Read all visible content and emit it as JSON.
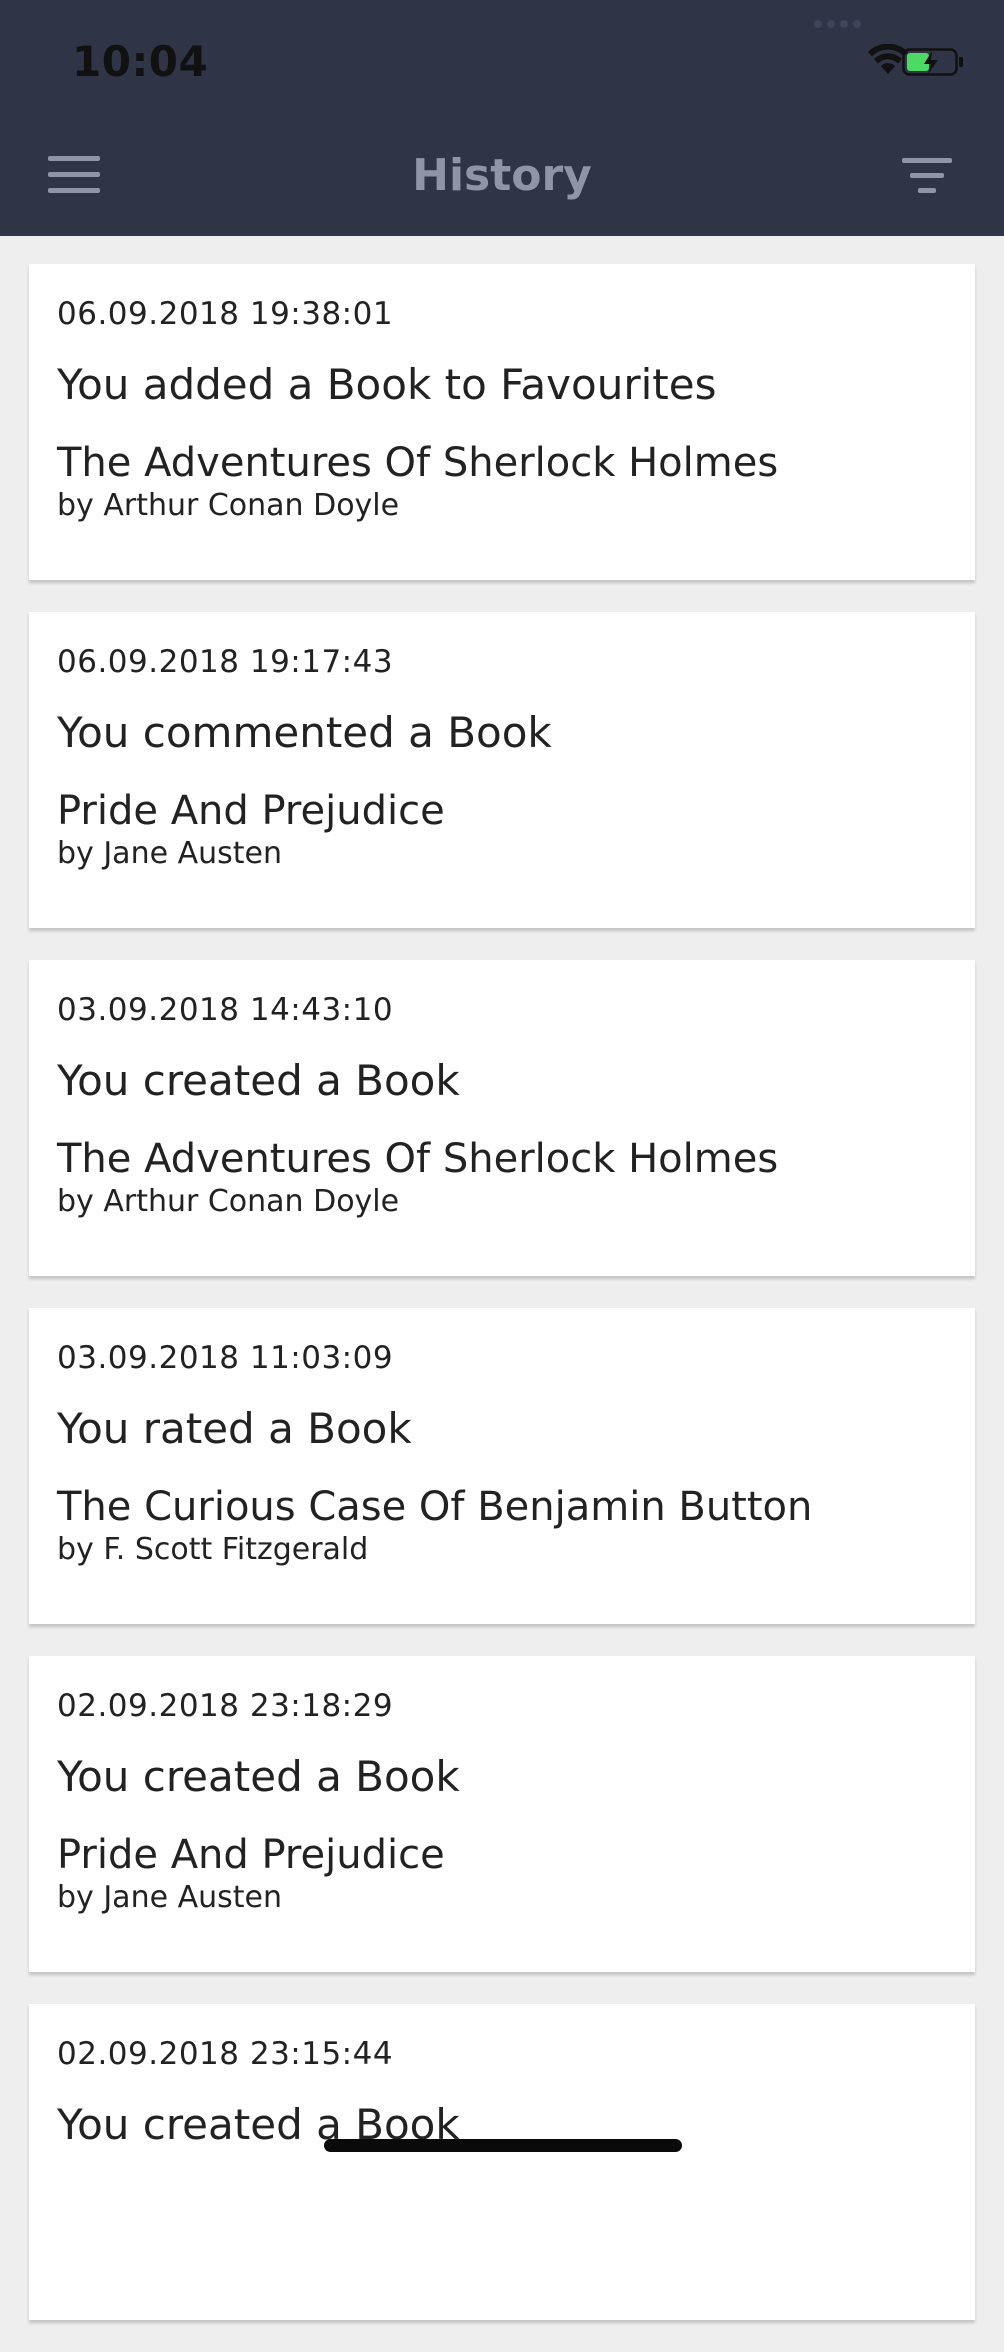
{
  "status_bar": {
    "time": "10:04",
    "signal_icon": "cellular-signal-icon",
    "wifi_icon": "wifi-icon",
    "battery_icon": "battery-charging-icon",
    "battery_color": "#4cd964"
  },
  "header": {
    "title": "History",
    "menu_icon": "hamburger-menu-icon",
    "filter_icon": "filter-icon",
    "background_color": "#2f3446",
    "title_color": "#8e95a6"
  },
  "history": [
    {
      "date": "06.09.2018 19:38:01",
      "action": "You added a Book to Favourites",
      "book_title": "The Adventures Of Sherlock Holmes",
      "book_author": "by Arthur Conan Doyle"
    },
    {
      "date": "06.09.2018 19:17:43",
      "action": "You commented a Book",
      "book_title": "Pride And Prejudice",
      "book_author": "by Jane Austen"
    },
    {
      "date": "03.09.2018 14:43:10",
      "action": "You created a Book",
      "book_title": "The Adventures Of Sherlock Holmes",
      "book_author": "by Arthur Conan Doyle"
    },
    {
      "date": "03.09.2018 11:03:09",
      "action": "You rated a Book",
      "book_title": "The Curious Case Of Benjamin Button",
      "book_author": "by F. Scott Fitzgerald"
    },
    {
      "date": "02.09.2018 23:18:29",
      "action": "You created a Book",
      "book_title": "Pride And Prejudice",
      "book_author": "by Jane Austen"
    },
    {
      "date": "02.09.2018 23:15:44",
      "action": "You created a Book",
      "book_title": "",
      "book_author": ""
    }
  ]
}
